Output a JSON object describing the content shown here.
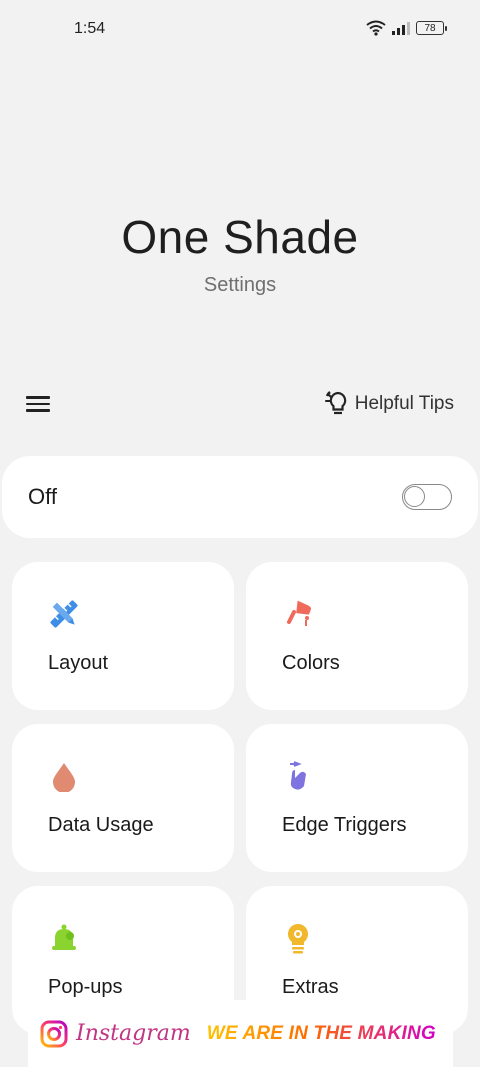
{
  "status_bar": {
    "time": "1:54",
    "battery": "78"
  },
  "header": {
    "title": "One Shade",
    "subtitle": "Settings"
  },
  "toolbar": {
    "tips_label": "Helpful Tips"
  },
  "master_toggle": {
    "label": "Off",
    "state": "off"
  },
  "tiles": [
    {
      "label": "Layout",
      "icon": "ruler-pencil-icon",
      "color": "#3f8ee6"
    },
    {
      "label": "Colors",
      "icon": "paint-roller-icon",
      "color": "#ef6a5a"
    },
    {
      "label": "Data Usage",
      "icon": "droplet-icon",
      "color": "#e08a72"
    },
    {
      "label": "Edge Triggers",
      "icon": "tap-gesture-icon",
      "color": "#7f73e0"
    },
    {
      "label": "Pop-ups",
      "icon": "bell-icon",
      "color": "#8bd42f"
    },
    {
      "label": "Extras",
      "icon": "lightbulb-icon",
      "color": "#f2b82b"
    }
  ],
  "banner": {
    "brand": "Instagram",
    "tagline": "WE ARE IN THE MAKING"
  }
}
